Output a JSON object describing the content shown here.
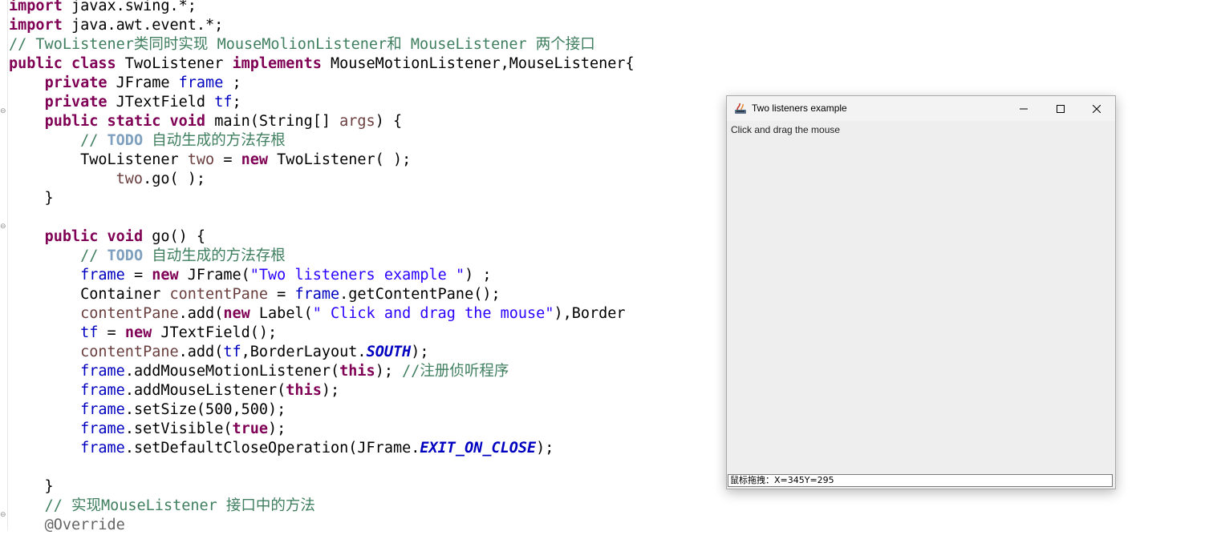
{
  "editor": {
    "lines": [
      [
        {
          "t": "import",
          "c": "kw"
        },
        {
          "t": " javax.swing.*;"
        }
      ],
      [
        {
          "t": "import",
          "c": "kw"
        },
        {
          "t": " java.awt.event.*;"
        }
      ],
      [
        {
          "t": "// TwoListener类同时实现 MouseMolionListener和 MouseListener 两个接口",
          "c": "cm"
        }
      ],
      [
        {
          "t": "public",
          "c": "kw"
        },
        {
          "t": " "
        },
        {
          "t": "class",
          "c": "kw"
        },
        {
          "t": " TwoListener "
        },
        {
          "t": "implements",
          "c": "kw"
        },
        {
          "t": " MouseMotionListener,MouseListener{"
        }
      ],
      [
        {
          "t": "    "
        },
        {
          "t": "private",
          "c": "kw"
        },
        {
          "t": " JFrame "
        },
        {
          "t": "frame",
          "c": "fld"
        },
        {
          "t": " ;"
        }
      ],
      [
        {
          "t": "    "
        },
        {
          "t": "private",
          "c": "kw"
        },
        {
          "t": " JTextField "
        },
        {
          "t": "tf",
          "c": "fld"
        },
        {
          "t": ";"
        }
      ],
      [
        {
          "t": "    "
        },
        {
          "t": "public",
          "c": "kw"
        },
        {
          "t": " "
        },
        {
          "t": "static",
          "c": "kw"
        },
        {
          "t": " "
        },
        {
          "t": "void",
          "c": "kw"
        },
        {
          "t": " main(String[] "
        },
        {
          "t": "args",
          "c": "lvar"
        },
        {
          "t": ") {"
        }
      ],
      [
        {
          "t": "        "
        },
        {
          "t": "// ",
          "c": "cm"
        },
        {
          "t": "TODO",
          "c": "todo"
        },
        {
          "t": " 自动生成的方法存根",
          "c": "cm"
        }
      ],
      [
        {
          "t": "        TwoListener "
        },
        {
          "t": "two",
          "c": "lvar"
        },
        {
          "t": " = "
        },
        {
          "t": "new",
          "c": "kw"
        },
        {
          "t": " TwoListener( );"
        }
      ],
      [
        {
          "t": "            "
        },
        {
          "t": "two",
          "c": "lvar"
        },
        {
          "t": ".go( );"
        }
      ],
      [
        {
          "t": "    }"
        }
      ],
      [
        {
          "t": ""
        }
      ],
      [
        {
          "t": "    "
        },
        {
          "t": "public",
          "c": "kw"
        },
        {
          "t": " "
        },
        {
          "t": "void",
          "c": "kw"
        },
        {
          "t": " go() {"
        }
      ],
      [
        {
          "t": "        "
        },
        {
          "t": "// ",
          "c": "cm"
        },
        {
          "t": "TODO",
          "c": "todo"
        },
        {
          "t": " 自动生成的方法存根",
          "c": "cm"
        }
      ],
      [
        {
          "t": "        "
        },
        {
          "t": "frame",
          "c": "fld"
        },
        {
          "t": " = "
        },
        {
          "t": "new",
          "c": "kw"
        },
        {
          "t": " JFrame("
        },
        {
          "t": "\"Two listeners example \"",
          "c": "str"
        },
        {
          "t": ") ;"
        }
      ],
      [
        {
          "t": "        Container "
        },
        {
          "t": "contentPane",
          "c": "lvar"
        },
        {
          "t": " = "
        },
        {
          "t": "frame",
          "c": "fld"
        },
        {
          "t": ".getContentPane();"
        }
      ],
      [
        {
          "t": "        "
        },
        {
          "t": "contentPane",
          "c": "lvar"
        },
        {
          "t": ".add("
        },
        {
          "t": "new",
          "c": "kw"
        },
        {
          "t": " Label("
        },
        {
          "t": "\" Click and drag the mouse\"",
          "c": "str"
        },
        {
          "t": "),Border"
        }
      ],
      [
        {
          "t": "        "
        },
        {
          "t": "tf",
          "c": "fld"
        },
        {
          "t": " = "
        },
        {
          "t": "new",
          "c": "kw"
        },
        {
          "t": " JTextField();"
        }
      ],
      [
        {
          "t": "        "
        },
        {
          "t": "contentPane",
          "c": "lvar"
        },
        {
          "t": ".add("
        },
        {
          "t": "tf",
          "c": "fld"
        },
        {
          "t": ",BorderLayout."
        },
        {
          "t": "SOUTH",
          "c": "cst"
        },
        {
          "t": ");"
        }
      ],
      [
        {
          "t": "        "
        },
        {
          "t": "frame",
          "c": "fld"
        },
        {
          "t": ".addMouseMotionListener("
        },
        {
          "t": "this",
          "c": "kw"
        },
        {
          "t": "); "
        },
        {
          "t": "//注册侦听程序",
          "c": "cm"
        }
      ],
      [
        {
          "t": "        "
        },
        {
          "t": "frame",
          "c": "fld"
        },
        {
          "t": ".addMouseListener("
        },
        {
          "t": "this",
          "c": "kw"
        },
        {
          "t": ");"
        }
      ],
      [
        {
          "t": "        "
        },
        {
          "t": "frame",
          "c": "fld"
        },
        {
          "t": ".setSize(500,500);"
        }
      ],
      [
        {
          "t": "        "
        },
        {
          "t": "frame",
          "c": "fld"
        },
        {
          "t": ".setVisible("
        },
        {
          "t": "true",
          "c": "kw"
        },
        {
          "t": ");"
        }
      ],
      [
        {
          "t": "        "
        },
        {
          "t": "frame",
          "c": "fld"
        },
        {
          "t": ".setDefaultCloseOperation(JFrame."
        },
        {
          "t": "EXIT_ON_CLOSE",
          "c": "cst"
        },
        {
          "t": ");"
        }
      ],
      [
        {
          "t": ""
        }
      ],
      [
        {
          "t": "    }"
        }
      ],
      [
        {
          "t": "    "
        },
        {
          "t": "// 实现MouseListener 接口中的方法",
          "c": "cm"
        }
      ],
      [
        {
          "t": "    "
        },
        {
          "t": "@Override",
          "c": "ann"
        }
      ]
    ]
  },
  "window": {
    "title": "Two listeners example",
    "label": "Click and drag the mouse",
    "status": "鼠标拖拽：X=345Y=295",
    "icons": {
      "app": "java-logo-icon",
      "minimize": "minimize-icon",
      "maximize": "maximize-icon",
      "close": "close-icon"
    }
  },
  "colors": {
    "keyword": "#7f0055",
    "comment": "#3f7f5f",
    "field": "#0000c0",
    "local": "#6a3e3e",
    "string": "#2a00ff",
    "annotation": "#646464"
  }
}
